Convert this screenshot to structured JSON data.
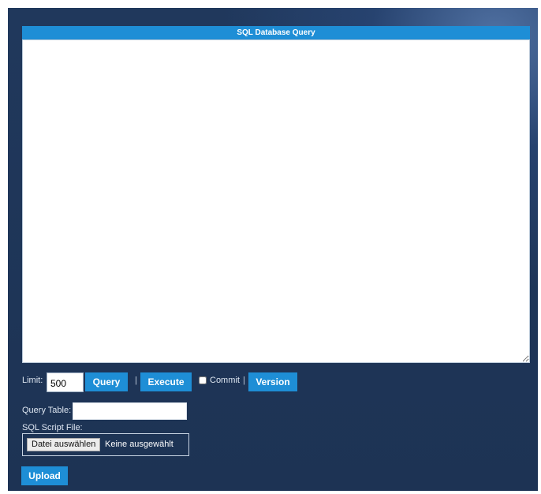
{
  "window": {
    "title": "SQL Database Query"
  },
  "editor": {
    "value": ""
  },
  "controls": {
    "limit_label": "Limit:",
    "limit_value": "500",
    "query_button": "Query",
    "separator_1": "|",
    "execute_button": "Execute",
    "commit_label": "Commit",
    "separator_2": "|",
    "version_button": "Version"
  },
  "query_table": {
    "label": "Query Table:",
    "value": ""
  },
  "script_file": {
    "label": "SQL Script File:",
    "choose_button": "Datei auswählen",
    "status": "Keine ausgewählt"
  },
  "upload": {
    "button": "Upload"
  },
  "colors": {
    "background": "#1e3557",
    "accent": "#1e8ed6"
  }
}
